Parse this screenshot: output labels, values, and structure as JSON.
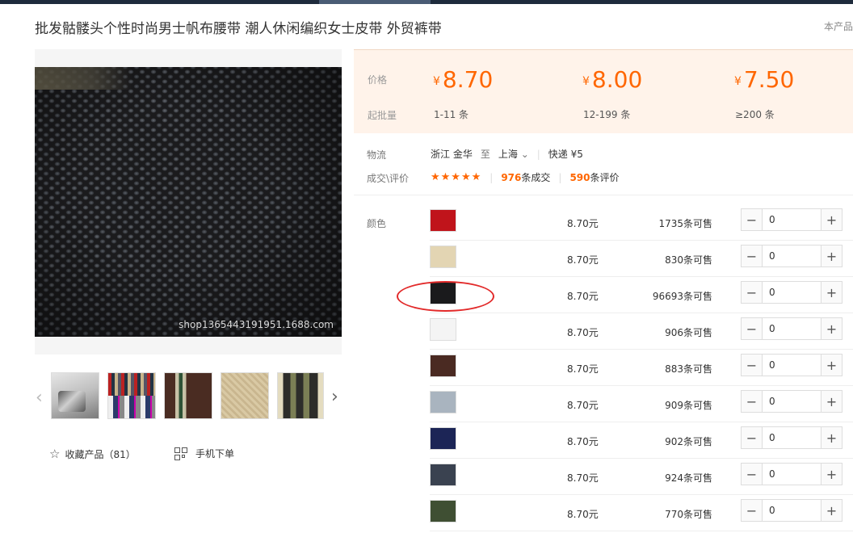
{
  "product": {
    "title": "批发骷髅头个性时尚男士帆布腰带 潮人休闲编织女士皮带 外贸裤带",
    "title_right": "本产品",
    "watermark": "shop1365443191951.1688.com"
  },
  "gallery": {
    "prev_icon": "chevron-left-icon",
    "next_icon": "chevron-right-icon",
    "thumbnails": [
      "buckle-belt",
      "multicolor-belts",
      "striped-brown",
      "beige-weave",
      "black-green-stripe"
    ]
  },
  "actions": {
    "favorite_label": "收藏产品（81）",
    "mobile_label": "手机下单"
  },
  "price_tiers": {
    "price_label": "价格",
    "min_qty_label": "起批量",
    "currency": "¥",
    "tiers": [
      {
        "price": "8.70",
        "qty": "1-11 条"
      },
      {
        "price": "8.00",
        "qty": "12-199 条"
      },
      {
        "price": "7.50",
        "qty": "≥200 条"
      }
    ]
  },
  "logistics": {
    "label": "物流",
    "from": "浙江 金华",
    "to_word": "至",
    "to": "上海",
    "shipping": "快递 ¥5"
  },
  "reviews": {
    "label": "成交\\评价",
    "stars": "★★★★★",
    "deals_count": "976",
    "deals_text": "条成交",
    "review_count": "590",
    "review_text": "条评价"
  },
  "sku": {
    "label": "颜色",
    "rows": [
      {
        "color": "#c0141b",
        "price": "8.70元",
        "stock": "1735条可售",
        "qty": "0"
      },
      {
        "color": "#e3d5b3",
        "price": "8.70元",
        "stock": "830条可售",
        "qty": "0"
      },
      {
        "color": "#1a1a1c",
        "price": "8.70元",
        "stock": "96693条可售",
        "qty": "0"
      },
      {
        "color": "#f4f4f4",
        "price": "8.70元",
        "stock": "906条可售",
        "qty": "0"
      },
      {
        "color": "#4a2a22",
        "price": "8.70元",
        "stock": "883条可售",
        "qty": "0"
      },
      {
        "color": "#a9b4bf",
        "price": "8.70元",
        "stock": "909条可售",
        "qty": "0"
      },
      {
        "color": "#1c2556",
        "price": "8.70元",
        "stock": "902条可售",
        "qty": "0"
      },
      {
        "color": "#3a4250",
        "price": "8.70元",
        "stock": "924条可售",
        "qty": "0"
      },
      {
        "color": "#3f4f33",
        "price": "8.70元",
        "stock": "770条可售",
        "qty": "0"
      }
    ]
  },
  "colors": {
    "accent": "#ff6600",
    "annotation": "#e22a2a",
    "price_bg": "#fff3ea"
  }
}
